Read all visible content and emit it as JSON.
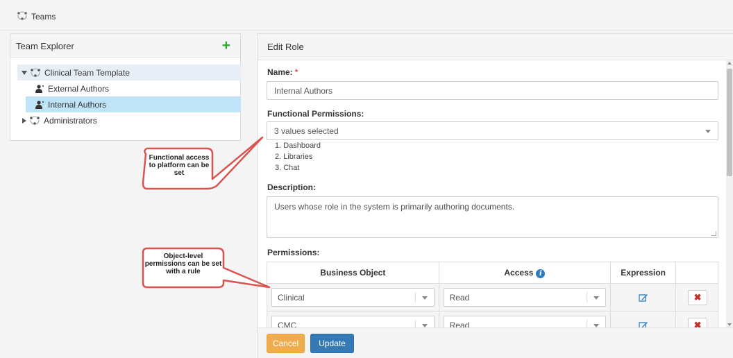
{
  "app": {
    "title": "Teams"
  },
  "explorer": {
    "title": "Team Explorer",
    "add_label": "+",
    "tree": {
      "root": "Clinical Team Template",
      "children": [
        "External Authors",
        "Internal Authors"
      ],
      "sibling": "Administrators"
    }
  },
  "edit": {
    "title": "Edit Role",
    "name_label": "Name:",
    "required_mark": "*",
    "name_value": "Internal Authors",
    "func_label": "Functional Permissions:",
    "func_value": "3 values selected",
    "func_items": [
      "1. Dashboard",
      "2. Libraries",
      "3. Chat"
    ],
    "desc_label": "Description:",
    "desc_value": "Users whose role in the system is primarily authoring documents.",
    "perm_label": "Permissions:",
    "table": {
      "headers": [
        "Business Object",
        "Access",
        "Expression"
      ],
      "rows": [
        {
          "object": "Clinical",
          "access": "Read"
        },
        {
          "object": "CMC",
          "access": "Read"
        }
      ]
    },
    "cancel": "Cancel",
    "update": "Update"
  },
  "callouts": {
    "first": "Functional access to platform can be set",
    "second": "Object-level permissions can be set with a rule"
  },
  "colors": {
    "accent": "#337ab7",
    "warn": "#f0ad4e",
    "selected": "#bfe3f7",
    "add": "#35a63a",
    "callout": "#d9534f"
  }
}
